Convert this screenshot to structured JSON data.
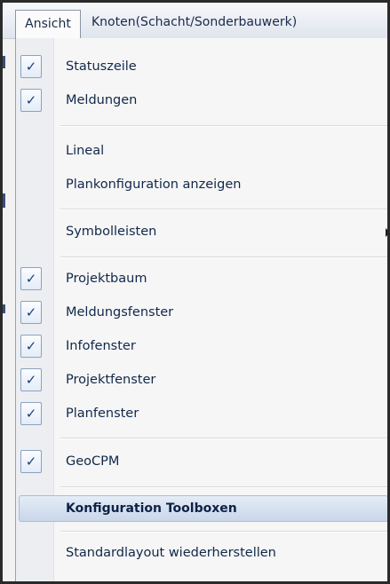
{
  "menubar": {
    "items": [
      {
        "label": "Ansicht"
      },
      {
        "label": "Knoten(Schacht/Sonderbauwerk)"
      }
    ]
  },
  "menu": {
    "items": [
      {
        "label": "Statuszeile",
        "checked": true
      },
      {
        "label": "Meldungen",
        "checked": true
      },
      {
        "label": "Lineal",
        "checked": false
      },
      {
        "label": "Plankonfiguration anzeigen",
        "checked": false
      },
      {
        "label": "Symbolleisten",
        "checked": false,
        "submenu": true
      },
      {
        "label": "Projektbaum",
        "checked": true
      },
      {
        "label": "Meldungsfenster",
        "checked": true
      },
      {
        "label": "Infofenster",
        "checked": true
      },
      {
        "label": "Projektfenster",
        "checked": true
      },
      {
        "label": "Planfenster",
        "checked": true
      },
      {
        "label": "GeoCPM",
        "checked": true
      },
      {
        "label": "Konfiguration Toolboxen",
        "checked": false,
        "highlighted": true
      },
      {
        "label": "Standardlayout wiederherstellen",
        "checked": false
      }
    ],
    "check_glyph": "✓",
    "submenu_icon": "submenu-arrow-icon"
  }
}
